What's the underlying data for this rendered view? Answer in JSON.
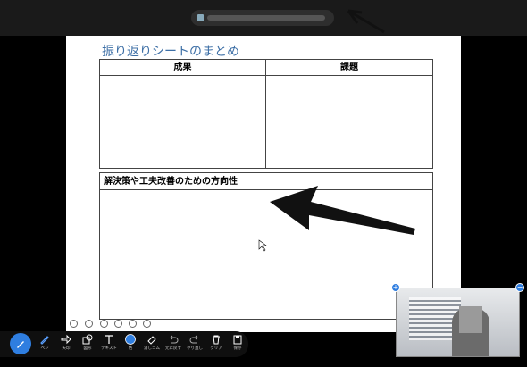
{
  "window": {
    "title_blurred": ""
  },
  "slide": {
    "title": "振り返りシートのまとめ",
    "table_top": {
      "col1": "成果",
      "col2": "課題"
    },
    "table_bottom": {
      "header": "解決策や工夫改善のための方向性"
    }
  },
  "toolbar": {
    "items": [
      {
        "label": "ペン",
        "icon": "pen-icon"
      },
      {
        "label": "矢印",
        "icon": "arrow-icon"
      },
      {
        "label": "図形",
        "icon": "shapes-icon"
      },
      {
        "label": "テキスト",
        "icon": "text-icon"
      },
      {
        "label": "色",
        "icon": "color-icon"
      },
      {
        "label": "消しゴム",
        "icon": "eraser-icon"
      },
      {
        "label": "元に戻す",
        "icon": "undo-icon"
      },
      {
        "label": "やり直し",
        "icon": "redo-icon"
      },
      {
        "label": "クリア",
        "icon": "trash-icon"
      },
      {
        "label": "保存",
        "icon": "save-icon"
      }
    ],
    "accent": "#2f7ee0"
  }
}
